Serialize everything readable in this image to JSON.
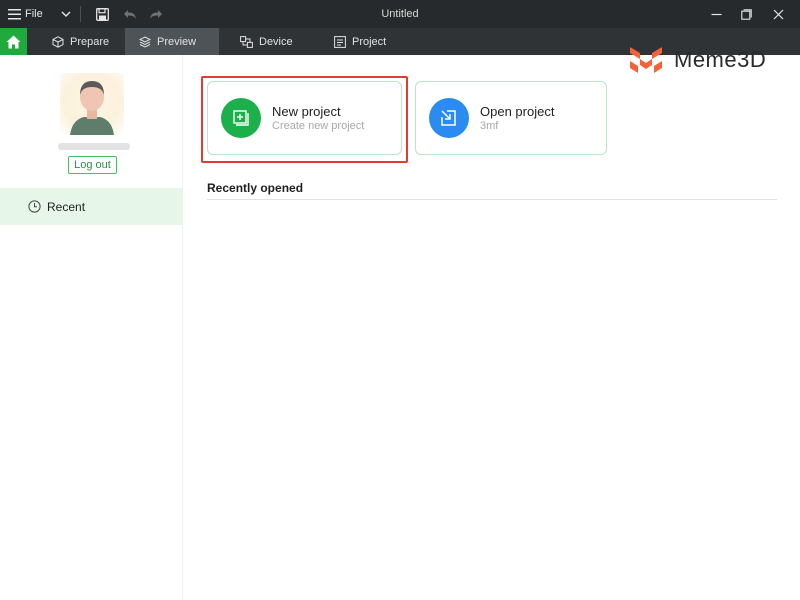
{
  "titlebar": {
    "menu_label": "File",
    "window_title": "Untitled"
  },
  "tabs": [
    {
      "label": "Prepare",
      "icon": "cube-icon",
      "active": false
    },
    {
      "label": "Preview",
      "icon": "layers-icon",
      "active": true
    },
    {
      "label": "Device",
      "icon": "device-icon",
      "active": false
    },
    {
      "label": "Project",
      "icon": "project-icon",
      "active": false
    }
  ],
  "sidebar": {
    "logout_label": "Log out",
    "recent_label": "Recent"
  },
  "cards": {
    "new_project": {
      "title": "New project",
      "subtitle": "Create new project"
    },
    "open_project": {
      "title": "Open project",
      "subtitle": "3mf"
    }
  },
  "main": {
    "recent_heading": "Recently opened"
  },
  "logo": {
    "text": "Meme3D",
    "color": "#f4623a"
  },
  "colors": {
    "accent_green": "#1faa3c",
    "accent_blue": "#2a8bf2",
    "highlight_red": "#e53935"
  }
}
